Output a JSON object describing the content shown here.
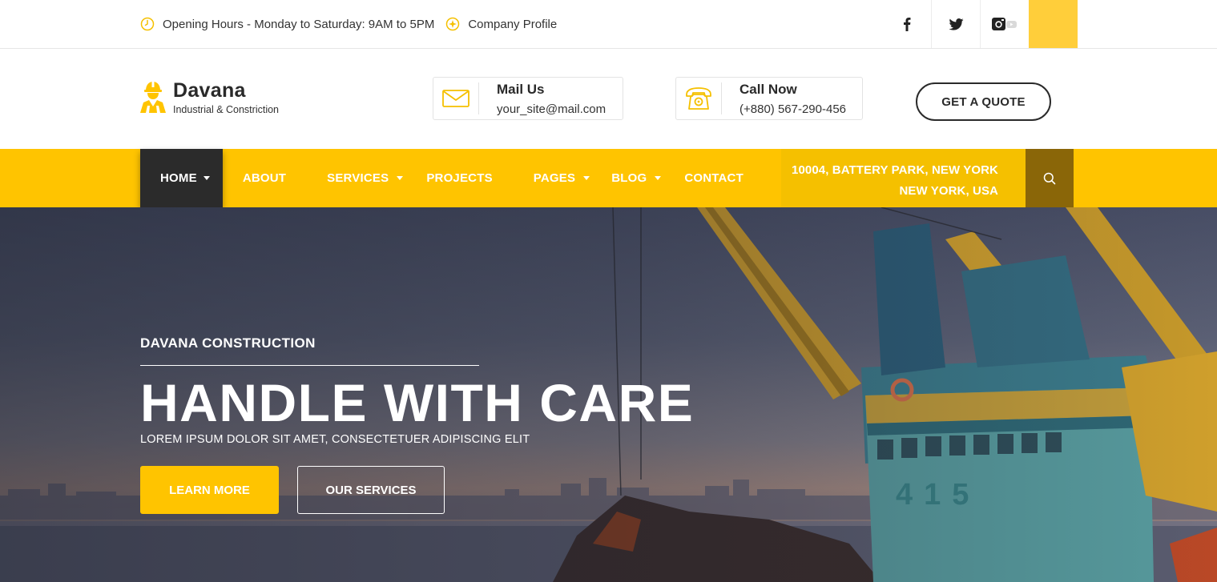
{
  "topbar": {
    "opening_hours": "Opening Hours - Monday to Saturday: 9AM to 5PM",
    "company_profile": "Company Profile",
    "social": [
      "f",
      "twitter",
      "instagram"
    ]
  },
  "header": {
    "brand_name": "Davana",
    "brand_tagline": "Industrial & Constriction",
    "mail": {
      "title": "Mail Us",
      "value": "your_site@mail.com"
    },
    "call": {
      "title": "Call Now",
      "value": "(+880) 567-290-456"
    },
    "quote_label": "GET A QUOTE"
  },
  "nav": {
    "items": [
      {
        "label": "HOME",
        "has_dropdown": true,
        "active": true
      },
      {
        "label": "ABOUT",
        "has_dropdown": false
      },
      {
        "label": "SERVICES",
        "has_dropdown": true
      },
      {
        "label": "PROJECTS",
        "has_dropdown": false
      },
      {
        "label": "PAGES",
        "has_dropdown": true
      },
      {
        "label": "BLOG",
        "has_dropdown": true
      },
      {
        "label": "CONTACT",
        "has_dropdown": false
      }
    ],
    "address_line1": "10004, BATTERY PARK, NEW YORK",
    "address_line2": "NEW YORK, USA"
  },
  "hero": {
    "eyebrow": "DAVANA CONSTRUCTION",
    "headline": "HANDLE WITH CARE",
    "subtitle": "LOREM IPSUM DOLOR SIT AMET, CONSECTETUER ADIPISCING ELIT",
    "primary_button": "LEARN MORE",
    "secondary_button": "OUR SERVICES",
    "crane_number": "415"
  },
  "colors": {
    "accent": "#ffc400",
    "dark": "#2b2b2b",
    "search_bg": "#8a6608"
  }
}
